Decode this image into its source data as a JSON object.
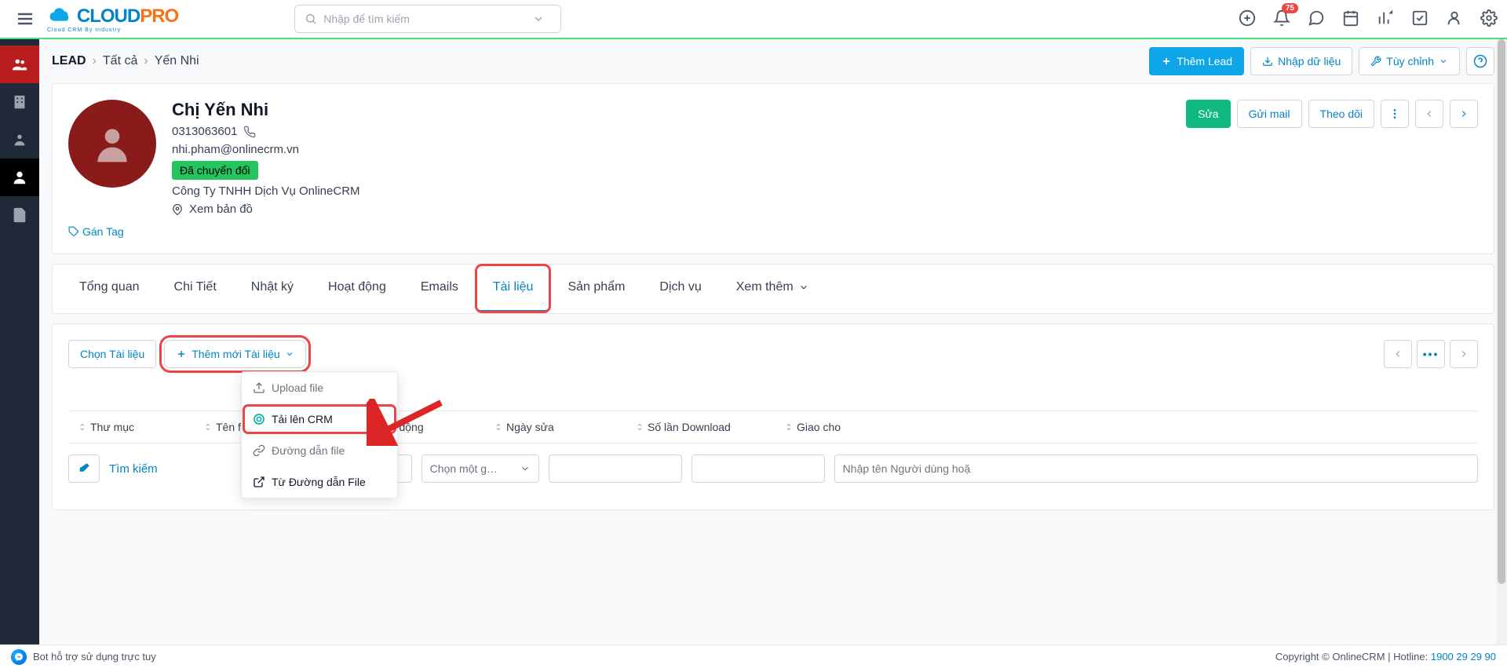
{
  "header": {
    "logo_main": "CLOUD",
    "logo_accent": "PRO",
    "logo_sub": "Cloud CRM By Industry",
    "search_placeholder": "Nhập để tìm kiếm",
    "notif_count": "75"
  },
  "breadcrumb": {
    "root": "LEAD",
    "level1": "Tất cả",
    "level2": "Yến Nhi",
    "add_btn": "Thêm Lead",
    "import_btn": "Nhập dữ liệu",
    "customize_btn": "Tùy chỉnh"
  },
  "profile": {
    "name": "Chị Yến Nhi",
    "phone": "0313063601",
    "email": "nhi.pham@onlinecrm.vn",
    "status": "Đã chuyển đổi",
    "company": "Công Ty TNHH Dịch Vụ OnlineCRM",
    "map_link": "Xem bản đồ",
    "tag_link": "Gán Tag",
    "edit_btn": "Sửa",
    "mail_btn": "Gửi mail",
    "follow_btn": "Theo dõi"
  },
  "tabs": {
    "t0": "Tổng quan",
    "t1": "Chi Tiết",
    "t2": "Nhật ký",
    "t3": "Hoạt động",
    "t4": "Emails",
    "t5": "Tài liệu",
    "t6": "Sản phẩm",
    "t7": "Dịch vụ",
    "t8": "Xem thêm"
  },
  "docs": {
    "select_btn": "Chọn Tài liệu",
    "add_btn": "Thêm mới Tài liệu",
    "dd_upload": "Upload file",
    "dd_crm": "Tải lên CRM",
    "dd_link": "Đường dẫn file",
    "dd_from_link": "Từ Đường dẫn File",
    "pag_dots": "•••",
    "col_folder": "Thư mục",
    "col_filename": "Tên file",
    "col_activity": "Hoạt động",
    "col_modified": "Ngày sửa",
    "col_downloads": "Số lần Download",
    "col_assigned": "Giao cho",
    "filter_search": "Tìm kiếm",
    "filter_activity_ph": "Chọn một g…",
    "filter_assigned_ph": "Nhập tên Người dùng hoặ"
  },
  "footer": {
    "bot_text": "Bot hỗ trợ sử dụng trực tuy",
    "copyright": "Copyright © OnlineCRM",
    "hotline_label": "Hotline:",
    "hotline_num": "1900 29 29 90"
  }
}
